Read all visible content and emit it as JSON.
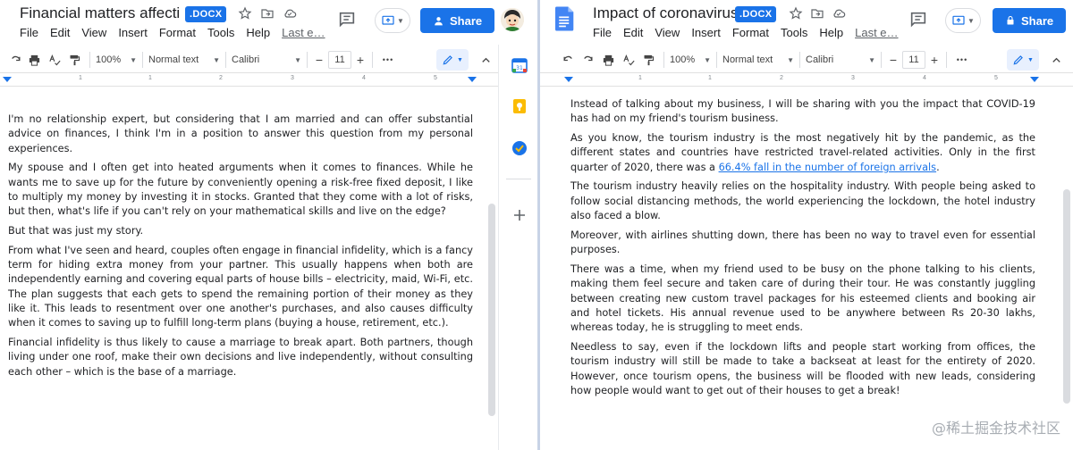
{
  "left": {
    "title": "Financial matters affecti…",
    "badge": ".DOCX",
    "menu": [
      "File",
      "Edit",
      "View",
      "Insert",
      "Format",
      "Tools",
      "Help"
    ],
    "last_edit": "Last e…",
    "share_label": "Share",
    "toolbar": {
      "zoom": "100%",
      "style": "Normal text",
      "font": "Calibri",
      "minus": "−",
      "size": "11",
      "plus": "+",
      "more": "•••"
    },
    "ruler_numbers": [
      "1",
      "1",
      "2",
      "3",
      "4",
      "5",
      "6"
    ],
    "paragraphs": [
      "I'm no relationship expert, but considering that I am married and can offer substantial advice on finances, I think I'm in a position to answer this question from my personal experiences.",
      "My spouse and I often get into heated arguments when it comes to finances. While he wants me to save up for the future by conveniently opening a risk-free fixed deposit, I like to multiply my money by investing it in stocks. Granted that they come with a lot of risks, but then, what's life if you can't rely on your mathematical skills and live on the edge?",
      "But that was just my story.",
      "From what I've seen and heard, couples often engage in financial infidelity, which is a fancy term for hiding extra money from your partner. This usually happens when both are independently earning and covering equal parts of house bills – electricity, maid, Wi-Fi, etc. The plan suggests that each gets to spend the remaining portion of their money as they like it. This leads to resentment over one another's purchases, and also causes difficulty when it comes to saving up to fulfill long-term plans (buying a house, retirement, etc.).",
      "Financial infidelity is thus likely to cause a marriage to break apart. Both partners, though living under one roof, make their own decisions and live independently, without consulting each other – which is the base of a marriage."
    ]
  },
  "right": {
    "title": "Impact of coronavirus",
    "badge": ".DOCX",
    "menu": [
      "File",
      "Edit",
      "View",
      "Insert",
      "Format",
      "Tools",
      "Help"
    ],
    "last_edit": "Last e…",
    "share_label": "Share",
    "toolbar": {
      "zoom": "100%",
      "style": "Normal text",
      "font": "Calibri",
      "minus": "−",
      "size": "11",
      "plus": "+",
      "more": "•••"
    },
    "ruler_numbers": [
      "1",
      "1",
      "2",
      "3",
      "4",
      "5",
      "6"
    ],
    "p1": "Instead of talking about my business, I will be sharing with you the impact that COVID-19 has had on my friend's tourism business.",
    "p2_before": "As you know, the tourism industry is the most negatively hit by the pandemic, as the different states and countries have restricted travel-related activities. Only in the first quarter of 2020, there was a ",
    "p2_link": "66.4% fall in the number of foreign arrivals",
    "p2_after": ".",
    "p3": "The tourism industry heavily relies on the hospitality industry. With people being asked to follow social distancing methods, the world experiencing the lockdown, the hotel industry also faced a blow.",
    "p4": "Moreover, with airlines shutting down, there has been no way to travel even for essential purposes.",
    "p5": "There was a time, when my friend used to be busy on the phone talking to his clients, making them feel secure and taken care of during their tour. He was constantly juggling between creating new custom travel packages for his esteemed clients and booking air and hotel tickets. His annual revenue used to be anywhere between Rs 20-30 lakhs, whereas today, he is struggling to meet ends.",
    "p6": "Needless to say, even if the lockdown lifts and people start working from offices, the tourism industry will still be made to take a backseat at least for the entirety of 2020. However, once tourism opens, the business will be flooded with new leads, considering how people would want to get out of their houses to get a break!"
  },
  "side_panel": {
    "icons": [
      "calendar-icon",
      "keep-icon",
      "tasks-icon",
      "add-icon"
    ],
    "colors": {
      "calendar": "#1a73e8",
      "keep": "#fbbc04",
      "tasks": "#1a73e8"
    }
  },
  "watermark": "@稀土掘金技术社区",
  "colors": {
    "accent": "#1a73e8",
    "link": "#1a73e8"
  }
}
